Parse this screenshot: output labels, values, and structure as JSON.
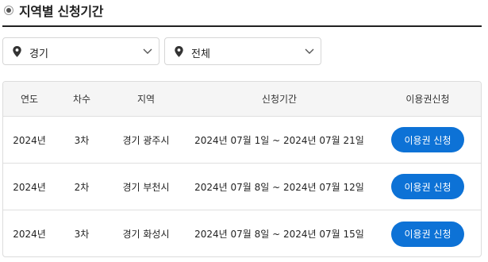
{
  "section": {
    "title": "지역별 신청기간"
  },
  "filters": {
    "region": {
      "value": "경기"
    },
    "city": {
      "value": "전체"
    }
  },
  "table": {
    "headers": [
      "연도",
      "차수",
      "지역",
      "신청기간",
      "이용권신청"
    ],
    "rows": [
      {
        "year": "2024년",
        "round": "3차",
        "region": "경기 광주시",
        "period": "2024년 07월 1일 ~ 2024년 07월 21일",
        "button": "이용권 신청"
      },
      {
        "year": "2024년",
        "round": "2차",
        "region": "경기 부천시",
        "period": "2024년 07월 8일 ~ 2024년 07월 12일",
        "button": "이용권 신청"
      },
      {
        "year": "2024년",
        "round": "3차",
        "region": "경기 화성시",
        "period": "2024년 07월 8일 ~ 2024년 07월 15일",
        "button": "이용권 신청"
      }
    ]
  },
  "colors": {
    "accent": "#0d72d6",
    "header_bg": "#f5f5f5",
    "border": "#dcdcdc"
  },
  "icons": {
    "select_prefix": "map-pin-icon",
    "select_suffix": "chevron-down-icon",
    "heading_bullet": "radio-bullet-icon"
  }
}
